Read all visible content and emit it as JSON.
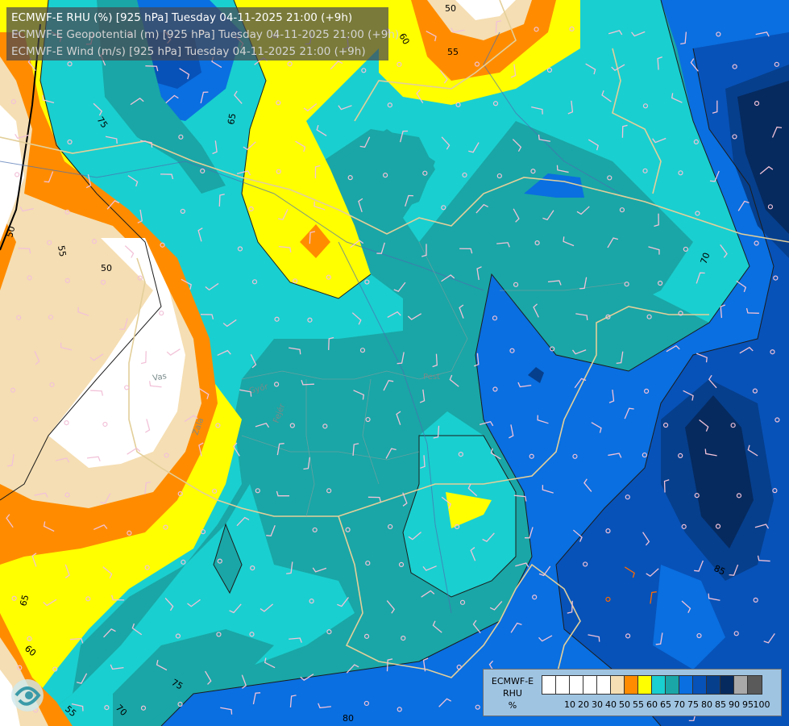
{
  "header": {
    "line1": "ECMWF-E RHU (%) [925 hPa] Tuesday 04-11-2025 21:00 (+9h)",
    "line2": "ECMWF-E Geopotential (m) [925 hPa] Tuesday 04-11-2025 21:00 (+9h)",
    "line3": "ECMWF-E Wind (m/s) [925 hPa] Tuesday 04-11-2025 21:00 (+9h)"
  },
  "legend": {
    "title_line1": "ECMWF-E",
    "title_line2": "RHU",
    "title_line3": "%",
    "colors": [
      "#ffffff",
      "#ffffff",
      "#ffffff",
      "#ffffff",
      "#ffffff",
      "#f5deb3",
      "#ff8c00",
      "#ffff00",
      "#1acfcf",
      "#1aa6a6",
      "#0a6fe0",
      "#0752b8",
      "#063f8c",
      "#062a5e",
      "#a9a9a9",
      "#5a5a5a"
    ],
    "labels": [
      "10",
      "20",
      "30",
      "40",
      "50",
      "55",
      "60",
      "65",
      "70",
      "75",
      "80",
      "85",
      "90",
      "95",
      "100"
    ]
  },
  "map": {
    "contour_labels": [
      "50",
      "60",
      "55",
      "65",
      "75",
      "50",
      "55",
      "70",
      "65",
      "60",
      "75",
      "70",
      "55",
      "80",
      "85",
      "50"
    ],
    "place_labels": [
      "Vas",
      "Zala",
      "Győr",
      "Fejér",
      "Pest"
    ]
  }
}
